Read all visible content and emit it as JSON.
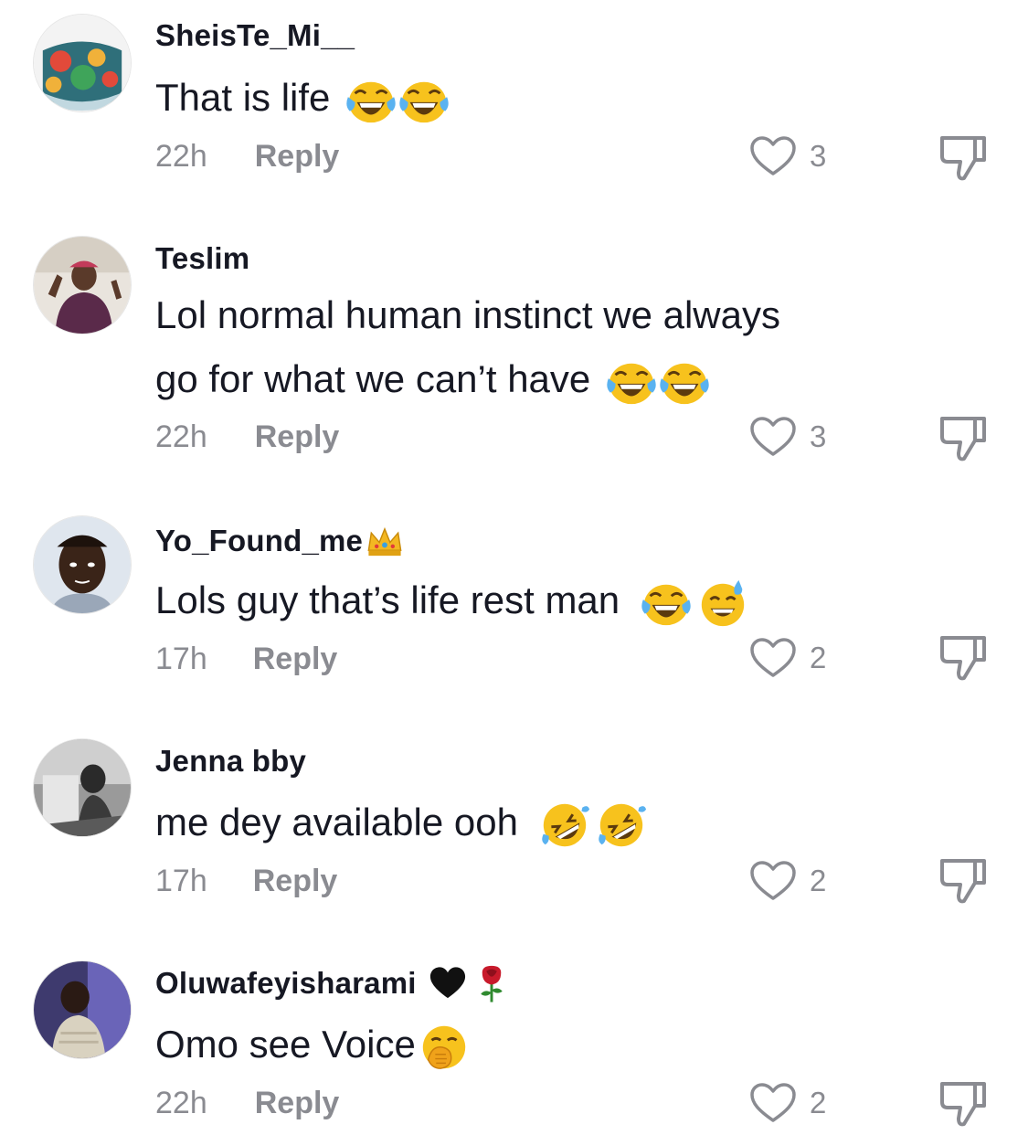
{
  "comments": [
    {
      "username": "SheisTe_Mi__",
      "text": "That is life",
      "emoji": [
        "tears-of-joy",
        "tears-of-joy"
      ],
      "time": "22h",
      "reply": "Reply",
      "likes": "3"
    },
    {
      "username": "Teslim",
      "text_line1": "Lol normal human instinct we always",
      "text_line2": "go for what we can’t have",
      "emoji": [
        "tears-of-joy",
        "tears-of-joy"
      ],
      "time": "22h",
      "reply": "Reply",
      "likes": "3"
    },
    {
      "username": "Yo_Found_me",
      "username_emoji": "crown",
      "text": "Lols guy that’s life rest man",
      "emoji": [
        "tears-of-joy",
        "grinning-sweat"
      ],
      "time": "17h",
      "reply": "Reply",
      "likes": "2"
    },
    {
      "username": "Jenna bby",
      "text": "me dey available ooh",
      "emoji": [
        "rolling-laughing",
        "rolling-laughing"
      ],
      "time": "17h",
      "reply": "Reply",
      "likes": "2"
    },
    {
      "username": "Oluwafeyisharami",
      "username_emoji": [
        "black-heart",
        "rose"
      ],
      "text": "Omo see Voice",
      "emoji": [
        "hand-over-mouth"
      ],
      "time": "22h",
      "reply": "Reply",
      "likes": "2"
    }
  ],
  "icons": {
    "like": "heart-outline-icon",
    "dislike": "thumbs-down-icon"
  },
  "colors": {
    "text": "#161823",
    "muted": "#8a8b91",
    "emoji": "#f7c21d"
  }
}
